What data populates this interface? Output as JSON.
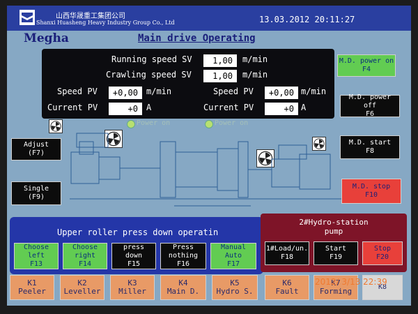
{
  "header": {
    "company_cn": "山西华晟重工集团公司",
    "company_en": "Shanxi Huasheng Heavy Industry Group Co., Ltd",
    "datetime": "13.03.2012 20:11:27"
  },
  "brand": "Megha",
  "page_title": "Main drive Operating",
  "readings": {
    "running_speed_sv": {
      "label": "Running speed SV",
      "value": "1,00",
      "unit": "m/min"
    },
    "crawling_speed_sv": {
      "label": "Crawling speed SV",
      "value": "1,00",
      "unit": "m/min"
    },
    "speed_pv_1": {
      "label": "Speed PV",
      "value": "+0,00",
      "unit": "m/min"
    },
    "current_pv_1": {
      "label": "Current PV",
      "value": "+0",
      "unit": "A"
    },
    "speed_pv_2": {
      "label": "Speed PV",
      "value": "+0,00",
      "unit": "m/min"
    },
    "current_pv_2": {
      "label": "Current PV",
      "value": "+0",
      "unit": "A"
    }
  },
  "right_buttons": {
    "md_power_on": [
      "M.D. power on",
      "F4"
    ],
    "md_power_off": [
      "M.D. power off",
      "F6"
    ],
    "md_start": [
      "M.D. start",
      "F8"
    ],
    "md_stop": [
      "M.D. stop",
      "F10"
    ]
  },
  "left_buttons": {
    "adjust": [
      "Adjust",
      "(F7)"
    ],
    "single": [
      "Single",
      "(F9)"
    ]
  },
  "indicators": {
    "left_label": "Power on",
    "right_label": "Power on"
  },
  "upper_roller": {
    "title": "Upper roller press down operatin",
    "buttons": {
      "choose_left": [
        "Choose",
        "left",
        "F13"
      ],
      "choose_right": [
        "Choose",
        "right",
        "F14"
      ],
      "press_down": [
        "press",
        "down",
        "F15"
      ],
      "press_nothing": [
        "Press",
        "nothing",
        "F16"
      ],
      "manual_auto": [
        "Manual",
        "Auto",
        "F17"
      ]
    }
  },
  "hydro_station": {
    "title_line1": "2#Hydro-station",
    "title_line2": "pump",
    "buttons": {
      "load_unload": [
        "1#Load/un.",
        "F18"
      ],
      "start": [
        "Start",
        "F19"
      ],
      "stop": [
        "Stop",
        "F20"
      ]
    }
  },
  "function_keys": [
    {
      "key": "K1",
      "label": "Peeler"
    },
    {
      "key": "K2",
      "label": "Leveller"
    },
    {
      "key": "K3",
      "label": "Miller"
    },
    {
      "key": "K4",
      "label": "Main D."
    },
    {
      "key": "K5",
      "label": "Hydro S."
    },
    {
      "key": "K6",
      "label": "Fault"
    },
    {
      "key": "K7",
      "label": "Forming"
    },
    {
      "key": "K8",
      "label": ""
    }
  ],
  "photo_timestamp": "2012/ 3/13 22:39",
  "colors": {
    "screen_bg": "#86a8c4",
    "header_bg": "#2a3fa0",
    "green_button": "#62cc52",
    "red_button": "#e8403a",
    "orange_key": "#e89a66",
    "maroon_panel": "#7e1428",
    "blue_panel": "#2436a8"
  }
}
